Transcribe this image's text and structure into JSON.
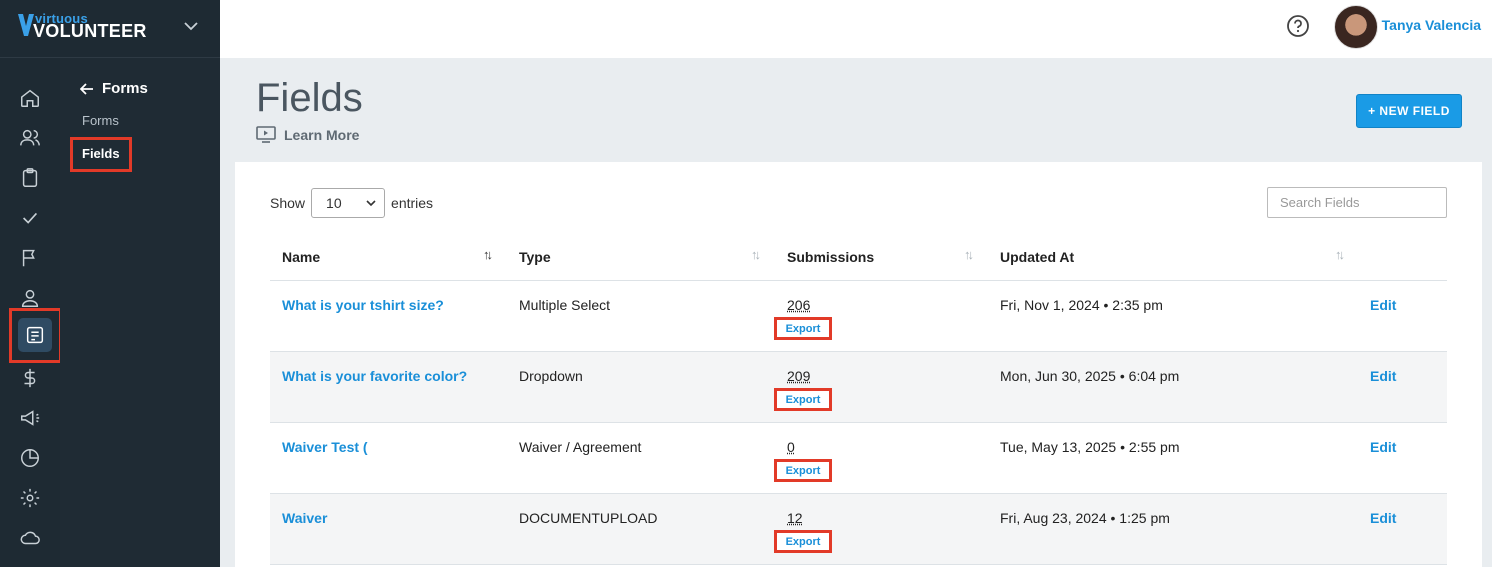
{
  "brand": {
    "small": "virtuous",
    "big": "VOLUNTEER"
  },
  "user": {
    "name": "Tanya Valencia"
  },
  "subnav": {
    "back_label": "Forms",
    "items": [
      {
        "label": "Forms"
      },
      {
        "label": "Fields"
      }
    ]
  },
  "page": {
    "title": "Fields",
    "learn_more": "Learn More",
    "new_button": "+ NEW FIELD"
  },
  "table_controls": {
    "show_label": "Show",
    "entries_value": "10",
    "entries_label": "entries",
    "search_placeholder": "Search Fields"
  },
  "columns": [
    {
      "label": "Name"
    },
    {
      "label": "Type"
    },
    {
      "label": "Submissions"
    },
    {
      "label": "Updated At"
    }
  ],
  "rows": [
    {
      "name": "What is your tshirt size?",
      "type": "Multiple Select",
      "submissions": "206",
      "export": "Export",
      "updated": "Fri, Nov 1, 2024 • 2:35 pm",
      "action": "Edit"
    },
    {
      "name": "What is your favorite color?",
      "type": "Dropdown",
      "submissions": "209",
      "export": "Export",
      "updated": "Mon, Jun 30, 2025 • 6:04 pm",
      "action": "Edit"
    },
    {
      "name": "Waiver Test (",
      "type": "Waiver / Agreement",
      "submissions": "0",
      "export": "Export",
      "updated": "Tue, May 13, 2025 • 2:55 pm",
      "action": "Edit"
    },
    {
      "name": "Waiver",
      "type": "DOCUMENTUPLOAD",
      "submissions": "12",
      "export": "Export",
      "updated": "Fri, Aug 23, 2024 • 1:25 pm",
      "action": "Edit"
    }
  ],
  "icons": [
    "home-icon",
    "people-icon",
    "clipboard-icon",
    "check-icon",
    "flag-icon",
    "person-icon",
    "form-icon",
    "dollar-icon",
    "megaphone-icon",
    "pie-chart-icon",
    "gear-icon",
    "cloud-icon"
  ],
  "colors": {
    "accent": "#1a9be6",
    "highlight": "#e23a28",
    "sidebar": "#1e2a33"
  }
}
